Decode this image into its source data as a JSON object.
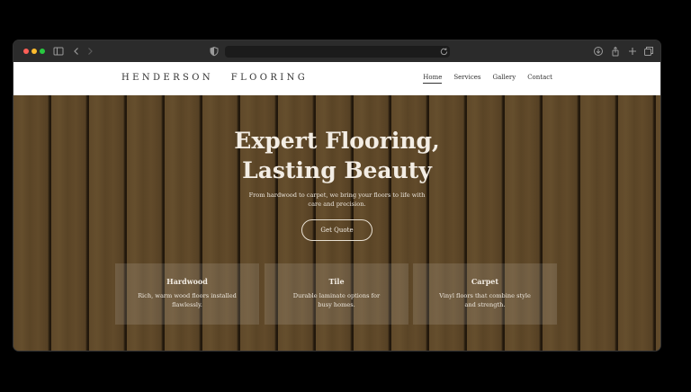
{
  "site": {
    "brand": "HENDERSON   FLOORING",
    "nav": [
      {
        "label": "Home",
        "active": true
      },
      {
        "label": "Services"
      },
      {
        "label": "Gallery"
      },
      {
        "label": "Contact"
      }
    ]
  },
  "browser": {
    "icons": [
      "sidebar-icon",
      "back-icon",
      "forward-icon",
      "shield-icon",
      "reload-icon",
      "download-icon",
      "share-icon",
      "plus-icon",
      "tabs-icon"
    ]
  },
  "hero": {
    "title_line1": "Expert Flooring,",
    "title_line2": "Lasting Beauty",
    "subtitle": "From hardwood to carpet, we bring your floors to life with care and precision.",
    "cta": "Get Quote"
  },
  "cards": [
    {
      "title": "Hardwood",
      "text": "Rich, warm wood floors installed flawlessly."
    },
    {
      "title": "Tile",
      "text": "Durable laminate options for busy homes."
    },
    {
      "title": "Carpet",
      "text": "Vinyl floors that combine style and strength."
    }
  ],
  "colors": {
    "accent_text": "#f3ede4",
    "header_bg": "#ffffff",
    "wood": "#6b5332"
  }
}
